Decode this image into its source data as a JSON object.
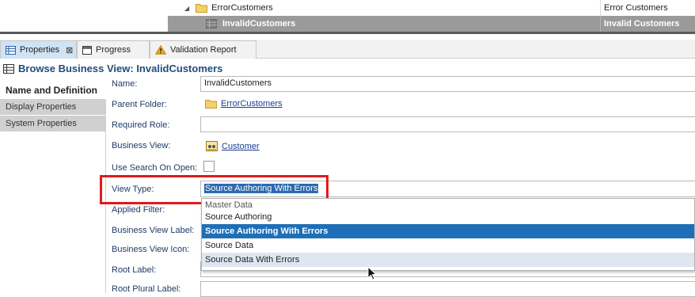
{
  "tree": {
    "row1": {
      "name": "ErrorCustomers",
      "label": "Error Customers"
    },
    "row2": {
      "name": "InvalidCustomers",
      "label": "Invalid Customers"
    }
  },
  "tabs": [
    {
      "label": "Properties",
      "icon": "properties-grid-icon"
    },
    {
      "label": "Progress",
      "icon": "progress-window-icon"
    },
    {
      "label": "Validation Report",
      "icon": "warning-icon"
    }
  ],
  "header": {
    "title": "Browse Business View: InvalidCustomers",
    "icon": "table-grid-icon"
  },
  "nav": [
    "Name and Definition",
    "Display Properties",
    "System Properties"
  ],
  "form": {
    "name_label": "Name:",
    "name_value": "InvalidCustomers",
    "parent_label": "Parent Folder:",
    "parent_value": "ErrorCustomers",
    "role_label": "Required Role:",
    "bv_label": "Business View:",
    "bv_value": "Customer",
    "search_label": "Use Search On Open:",
    "viewtype_label": "View Type:",
    "viewtype_value": "Source Authoring With Errors",
    "applied_label": "Applied Filter:",
    "bvlabel_label": "Business View Label:",
    "bvicon_label": "Business View Icon:",
    "root_label": "Root Label:",
    "rootplural_label": "Root Plural Label:"
  },
  "dropdown": {
    "options": [
      "Master Data",
      "Source Authoring",
      "Source Authoring With Errors",
      "Source Data",
      "Source Data With Errors"
    ]
  },
  "colors": {
    "accent": "#1e6fb7",
    "highlight_box": "#e01b1b",
    "header_text": "#1f4d7a"
  }
}
